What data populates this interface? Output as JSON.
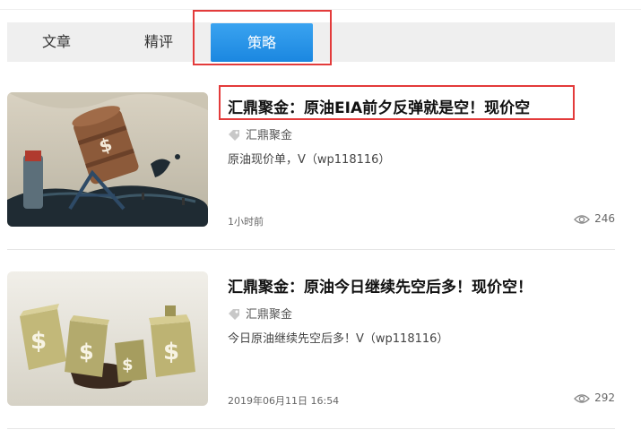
{
  "tabs": [
    {
      "label": "文章"
    },
    {
      "label": "精评"
    },
    {
      "label": "策略"
    }
  ],
  "active_tab": "策略",
  "articles": [
    {
      "title": "汇鼎聚金：原油EIA前夕反弹就是空！现价空",
      "tag": "汇鼎聚金",
      "summary": "原油现价单，V（wp118116）",
      "time": "1小时前",
      "views": "246",
      "image": "oil-barrel-cartoon-image"
    },
    {
      "title": "汇鼎聚金：原油今日继续先空后多！现价空！",
      "tag": "汇鼎聚金",
      "summary": "今日原油继续先空后多！V（wp118116）",
      "time": "2019年06月11日 16:54",
      "views": "292",
      "image": "oil-cans-dollar-image"
    }
  ],
  "colors": {
    "active_tab": "#1b87e0",
    "highlight_box": "#e33b3b",
    "tab_bar": "#efefef"
  }
}
